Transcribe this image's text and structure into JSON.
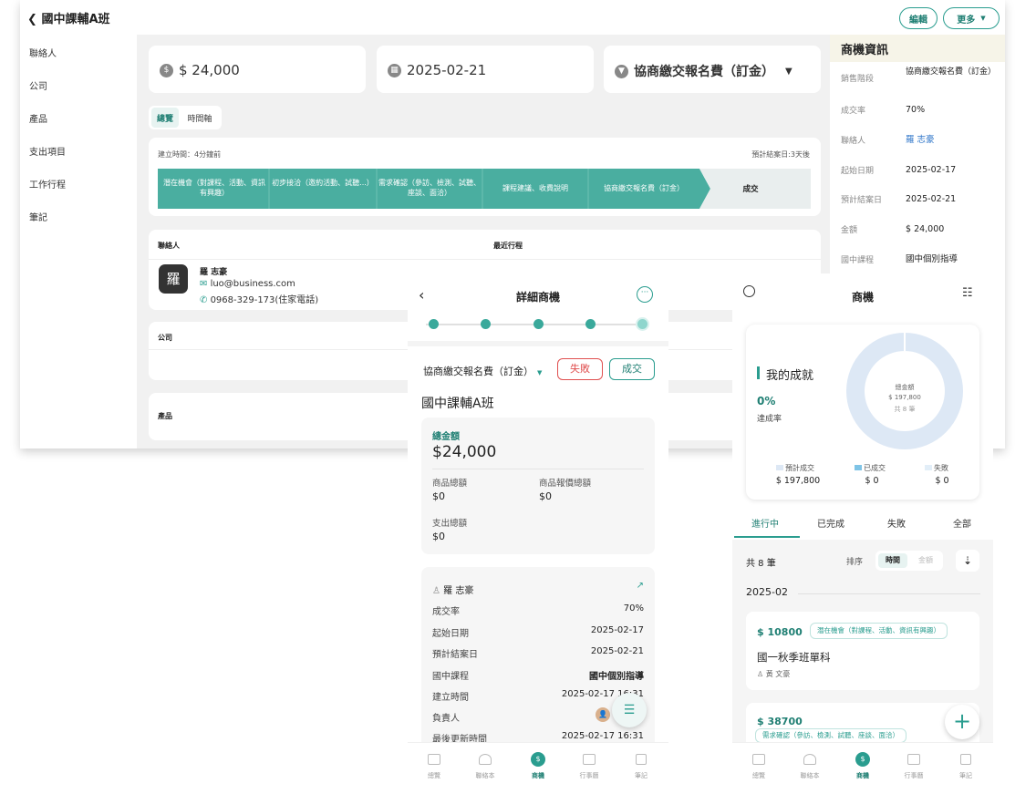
{
  "desktop": {
    "title": "國中課輔A班",
    "edit_label": "編輯",
    "more_label": "更多",
    "sidebar": [
      "聯絡人",
      "公司",
      "產品",
      "支出項目",
      "工作行程",
      "筆記"
    ],
    "amount": "$ 24,000",
    "date": "2025-02-21",
    "stage_select": "協商繳交報名費（訂金）",
    "view_tabs": [
      "總覽",
      "時間軸"
    ],
    "created_label": "建立時間：4分鐘前",
    "expected_label": "預計結案日:3天後",
    "stages": [
      "潛在機會（對課程、活動、資訊有興趣）",
      "初步接洽（邀約活動、試聽...）",
      "需求確認（參訪、檢測、試聽、座談、面洽）",
      "課程建議、收費說明",
      "協商繳交報名費（訂金）",
      "成交"
    ],
    "contact_header": "聯絡人",
    "recent_header": "最近行程",
    "contact_avatar": "羅",
    "contact_name": "羅 志豪",
    "contact_email": "luo@business.com",
    "contact_phone": "0968-329-173(住家電話)",
    "company_header": "公司",
    "product_header": "產品",
    "info": {
      "title": "商機資訊",
      "rows": [
        {
          "label": "銷售階段",
          "value": "協商繳交報名費（訂金）"
        },
        {
          "label": "成交率",
          "value": "70%"
        },
        {
          "label": "聯絡人",
          "value": "羅 志豪"
        },
        {
          "label": "起始日期",
          "value": "2025-02-17"
        },
        {
          "label": "預計結案日",
          "value": "2025-02-21"
        },
        {
          "label": "金額",
          "value": "$ 24,000"
        },
        {
          "label": "國中課程",
          "value": "國中個別指導"
        }
      ]
    }
  },
  "phone1": {
    "title": "詳細商機",
    "stage": "協商繳交報名費（訂金）",
    "lose_label": "失敗",
    "win_label": "成交",
    "deal_name": "國中課輔A班",
    "total_label": "總金額",
    "total_value": "$24,000",
    "product_total_label": "商品總額",
    "product_total_value": "$0",
    "quote_total_label": "商品報價總額",
    "quote_total_value": "$0",
    "expense_label": "支出總額",
    "expense_value": "$0",
    "contact": "羅 志豪",
    "rows": [
      {
        "label": "成交率",
        "value": "70%"
      },
      {
        "label": "起始日期",
        "value": "2025-02-17"
      },
      {
        "label": "預計結案日",
        "value": "2025-02-21"
      },
      {
        "label": "國中課程",
        "value": "國中個別指導"
      },
      {
        "label": "建立時間",
        "value": "2025-02-17 16:31"
      },
      {
        "label": "負責人",
        "value": ""
      },
      {
        "label": "最後更新時間",
        "value": "2025-02-17 16:31"
      }
    ],
    "nav": [
      "總覽",
      "聯絡本",
      "商機",
      "行事曆",
      "筆記"
    ]
  },
  "phone2": {
    "title": "商機",
    "my_achievement": "我的成就",
    "rate_value": "0%",
    "rate_label": "達成率",
    "donut_label": "總金額",
    "donut_amount": "$ 197,800",
    "donut_count": "共 8 筆",
    "legend": [
      {
        "label": "預計成交",
        "value": "$ 197,800",
        "color": "#dde8f5"
      },
      {
        "label": "已成交",
        "value": "$ 0",
        "color": "#7fc4e6"
      },
      {
        "label": "失敗",
        "value": "$ 0",
        "color": "#e2eef8"
      }
    ],
    "tabs": [
      "進行中",
      "已完成",
      "失敗",
      "全部"
    ],
    "count": "共 8 筆",
    "sort_label": "排序",
    "sort_time": "時間",
    "sort_amount": "金額",
    "month": "2025-02",
    "deals": [
      {
        "amount": "$ 10800",
        "stage": "潛在機會（對課程、活動、資訊有興趣）",
        "name": "國一秋季班單科",
        "owner": "黃 文豪"
      },
      {
        "amount": "$ 38700",
        "stage": "需求確認（參訪、檢測、試聽、座談、面洽）",
        "name": "",
        "owner": ""
      }
    ],
    "nav": [
      "總覽",
      "聯絡本",
      "商機",
      "行事曆",
      "筆記"
    ]
  },
  "colors": {
    "accent": "#2a9d8f",
    "stage": "#4aaea0",
    "warn": "#e05050"
  }
}
